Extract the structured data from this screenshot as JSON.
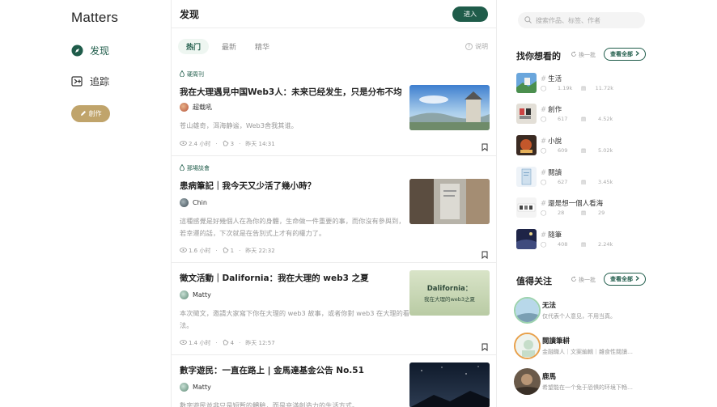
{
  "app": {
    "logo": "Matters"
  },
  "nav": {
    "discover": "发现",
    "following": "追踪",
    "create": "創作"
  },
  "header": {
    "title": "发现",
    "enter": "进入"
  },
  "tabs": [
    {
      "label": "热门",
      "active": true
    },
    {
      "label": "最新",
      "active": false
    },
    {
      "label": "精华",
      "active": false
    }
  ],
  "explain_label": "说明",
  "articles": [
    {
      "tag": "硬周刊",
      "title": "我在大理遇見中国Web3人：未来已经发生，只是分布不均",
      "author": "超载吼",
      "summary": "苍山雄奇，洱海静谧，Web3舍我其谁。",
      "read_time": "2.4 小时",
      "appreciations": "3",
      "date": "昨天 14:31"
    },
    {
      "tag": "那場談會",
      "title": "患病筆記｜我今天又少活了幾小時？",
      "author": "Chin",
      "summary": "這種感覺是好幾個人在為你的身體，生命做一件重要的事，而你沒有參與到，若幸運的話，下次就是在告別式上才有的權力了。",
      "read_time": "1.6 小时",
      "appreciations": "1",
      "date": "昨天 22:32"
    },
    {
      "tag": "",
      "title": "徵文活動｜Dalifornia：我在大理的 web3 之夏",
      "author": "Matty",
      "summary": "本次徵文，邀請大家寫下你在大理的 web3 故事，或者你對 web3 在大理的看法。",
      "read_time": "1.4 小时",
      "appreciations": "4",
      "date": "昨天 12:57",
      "thumb_text_1": "Dalifornia：",
      "thumb_text_2": "我在大理的web3之夏"
    },
    {
      "tag": "",
      "title": "數字遊民：一直在路上 | 金馬達基金公告 No.51",
      "author": "Matty",
      "summary": "數字遊民並非只是短暫的體驗，而是充滿創造力的生活方式。"
    }
  ],
  "right": {
    "search_placeholder": "搜索作品、标签、作者",
    "topics_title": "找你想看的",
    "refresh": "換一批",
    "view_all": "查看全部",
    "topics": [
      {
        "name": "生活",
        "followers": "1.19k",
        "articles": "11.72k"
      },
      {
        "name": "創作",
        "followers": "617",
        "articles": "4.52k"
      },
      {
        "name": "小說",
        "followers": "609",
        "articles": "5.02k"
      },
      {
        "name": "閱讀",
        "followers": "627",
        "articles": "3.45k"
      },
      {
        "name": "還是想一個人看海",
        "followers": "28",
        "articles": "29"
      },
      {
        "name": "隨筆",
        "followers": "408",
        "articles": "2.24k"
      }
    ],
    "follow_title": "值得关注",
    "users": [
      {
        "name": "无法",
        "bio": "仅代表个人意见，不用当真。"
      },
      {
        "name": "閱讀筆耕",
        "bio": "金融職人｜文案編輯｜雜食性閱讀…"
      },
      {
        "name": "鹿馬",
        "bio": "希望能在一个免于恐惧的环境下畅…"
      }
    ]
  },
  "colors": {
    "brand": "#1f5c4a",
    "gold": "#c0a46b"
  }
}
